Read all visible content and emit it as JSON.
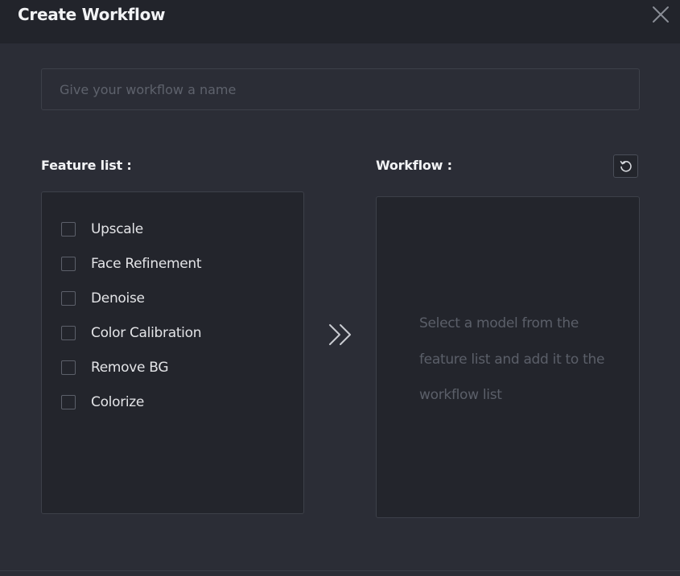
{
  "dialog": {
    "title": "Create Workflow",
    "close_icon": "close-icon"
  },
  "name_field": {
    "value": "",
    "placeholder": "Give your workflow a name"
  },
  "feature_list": {
    "label": "Feature list :",
    "items": [
      {
        "label": "Upscale",
        "checked": false
      },
      {
        "label": "Face Refinement",
        "checked": false
      },
      {
        "label": "Denoise",
        "checked": false
      },
      {
        "label": "Color Calibration",
        "checked": false
      },
      {
        "label": "Remove BG",
        "checked": false
      },
      {
        "label": "Colorize",
        "checked": false
      }
    ]
  },
  "add_arrow_icon": "double-chevron-right-icon",
  "workflow": {
    "label": "Workflow :",
    "reset_icon": "reset-icon",
    "empty_message": "Select a model from the feature list and add it to the workflow list"
  },
  "colors": {
    "background": "#2b2d36",
    "titlebar": "#22242b",
    "panel": "#23252c",
    "border": "#3d4049",
    "text": "#e6e7ea",
    "muted_text": "#5b5f69"
  }
}
